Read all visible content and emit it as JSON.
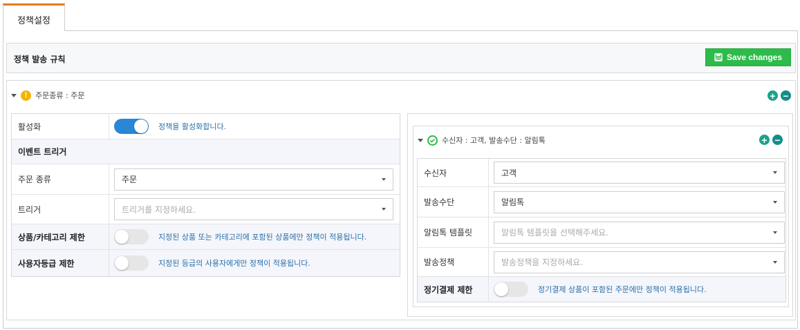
{
  "tabs": [
    {
      "label": "정책설정"
    }
  ],
  "rule": {
    "title": "정책 발송 규칙",
    "save_label": "Save changes"
  },
  "policy": {
    "title": "주문종류 : 주문",
    "active": {
      "label": "활성화",
      "state": "on",
      "hint": "정책을 활성화합니다."
    },
    "section_title": "이벤트 트리거",
    "order_type": {
      "label": "주문 종류",
      "value": "주문"
    },
    "trigger": {
      "label": "트리거",
      "placeholder": "트리거를 지정하세요."
    },
    "category_limit": {
      "label": "상품/카테고리 제한",
      "state": "off",
      "hint": "지정된 상품 또는 카테고리에 포함된 상품에만 정책이 적용됩니다."
    },
    "grade_limit": {
      "label": "사용자등급 제한",
      "state": "off",
      "hint": "지정된 등급의 사용자에게만 정책이 적용됩니다."
    }
  },
  "receiver": {
    "title": "수신자 : 고객, 발송수단 : 알림톡",
    "recipient": {
      "label": "수신자",
      "value": "고객"
    },
    "method": {
      "label": "발송수단",
      "value": "알림톡"
    },
    "template": {
      "label": "알림톡 템플릿",
      "placeholder": "알림톡 템플릿을 선택해주세요."
    },
    "send_policy": {
      "label": "발송정책",
      "placeholder": "발송정책을 지정하세요."
    },
    "subscription_limit": {
      "label": "정기결제 제한",
      "state": "off",
      "hint": "정기결제 상품이 포함된 주문에만 정책이 적용됩니다."
    }
  },
  "colors": {
    "accent_tab": "#e07b14",
    "save_green": "#2dbb4a",
    "toggle_on": "#2a86d6",
    "add_remove": "#1aa28c",
    "warning": "#f5b400",
    "hint_text": "#2a6fa8"
  },
  "icons": [
    "save-icon",
    "warning-icon",
    "check-circle-icon",
    "plus-circle-icon",
    "minus-circle-icon",
    "caret-down-icon",
    "dropdown-arrow-icon"
  ]
}
